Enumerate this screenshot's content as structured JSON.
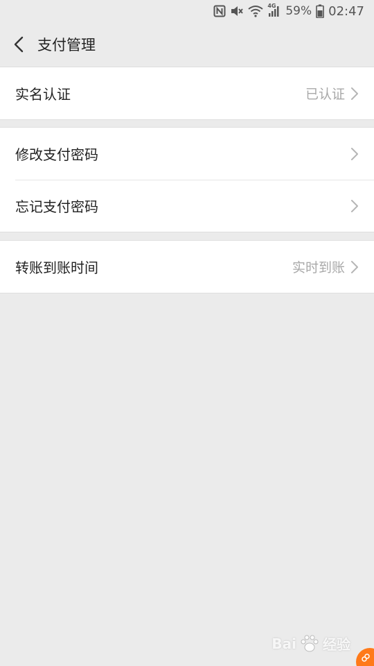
{
  "status_bar": {
    "battery_percent": "59%",
    "time": "02:47",
    "network_label": "4G",
    "icons": [
      "nfc-icon",
      "mute-icon",
      "wifi-icon",
      "signal-icon",
      "battery-icon"
    ]
  },
  "header": {
    "title": "支付管理"
  },
  "groups": [
    {
      "items": [
        {
          "label": "实名认证",
          "value": "已认证"
        }
      ]
    },
    {
      "items": [
        {
          "label": "修改支付密码",
          "value": ""
        },
        {
          "label": "忘记支付密码",
          "value": ""
        }
      ]
    },
    {
      "items": [
        {
          "label": "转账到账时间",
          "value": "实时到账"
        }
      ]
    }
  ],
  "watermark": {
    "text": "Bai",
    "text2": "经验"
  },
  "colors": {
    "background": "#ebebeb",
    "card": "#ffffff",
    "text": "#222222",
    "secondary_text": "#a8a8a8",
    "badge": "#ff7a1a"
  }
}
